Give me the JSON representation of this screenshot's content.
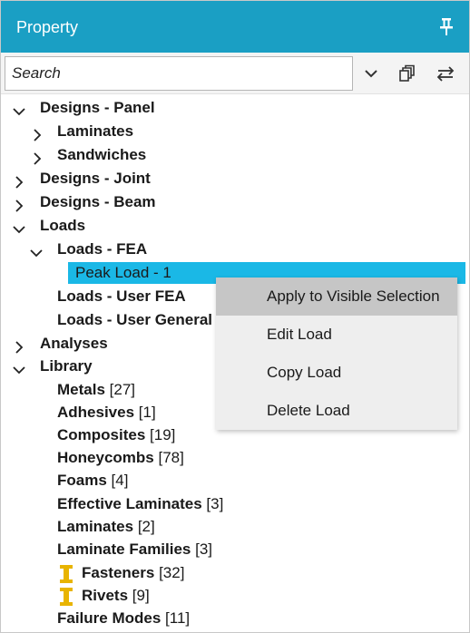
{
  "header": {
    "title": "Property",
    "pin_icon": "pin-icon"
  },
  "search": {
    "placeholder": "Search",
    "value": ""
  },
  "toolbar": {
    "icons": [
      "chevron-down-icon",
      "copy-icon",
      "swap-arrows-icon"
    ]
  },
  "tree": {
    "designs_panel": "Designs - Panel",
    "laminates": "Laminates",
    "sandwiches": "Sandwiches",
    "designs_joint": "Designs - Joint",
    "designs_beam": "Designs - Beam",
    "loads": "Loads",
    "loads_fea": "Loads - FEA",
    "peak_load": "Peak Load - 1",
    "loads_user_fea": "Loads - User FEA",
    "loads_user_general": "Loads - User General",
    "analyses": "Analyses",
    "library": "Library",
    "library_items": [
      {
        "label": "Metals",
        "count": "[27]"
      },
      {
        "label": "Adhesives",
        "count": "[1]"
      },
      {
        "label": "Composites",
        "count": "[19]"
      },
      {
        "label": "Honeycombs",
        "count": "[78]"
      },
      {
        "label": "Foams",
        "count": "[4]"
      },
      {
        "label": "Effective Laminates",
        "count": "[3]"
      },
      {
        "label": "Laminates",
        "count": "[2]"
      },
      {
        "label": "Laminate Families",
        "count": "[3]"
      },
      {
        "label": "Fasteners",
        "count": "[32]"
      },
      {
        "label": "Rivets",
        "count": "[9]"
      },
      {
        "label": "Failure Modes",
        "count": "[11]"
      }
    ]
  },
  "context_menu": {
    "items": [
      "Apply to Visible Selection",
      "Edit Load",
      "Copy Load",
      "Delete Load"
    ]
  },
  "colors": {
    "header": "#1a9fc4",
    "selection": "#1ab8e6",
    "menu_bg": "#eeeeee",
    "menu_highlight": "#c6c6c6",
    "fastener_icon": "#e8b400"
  }
}
